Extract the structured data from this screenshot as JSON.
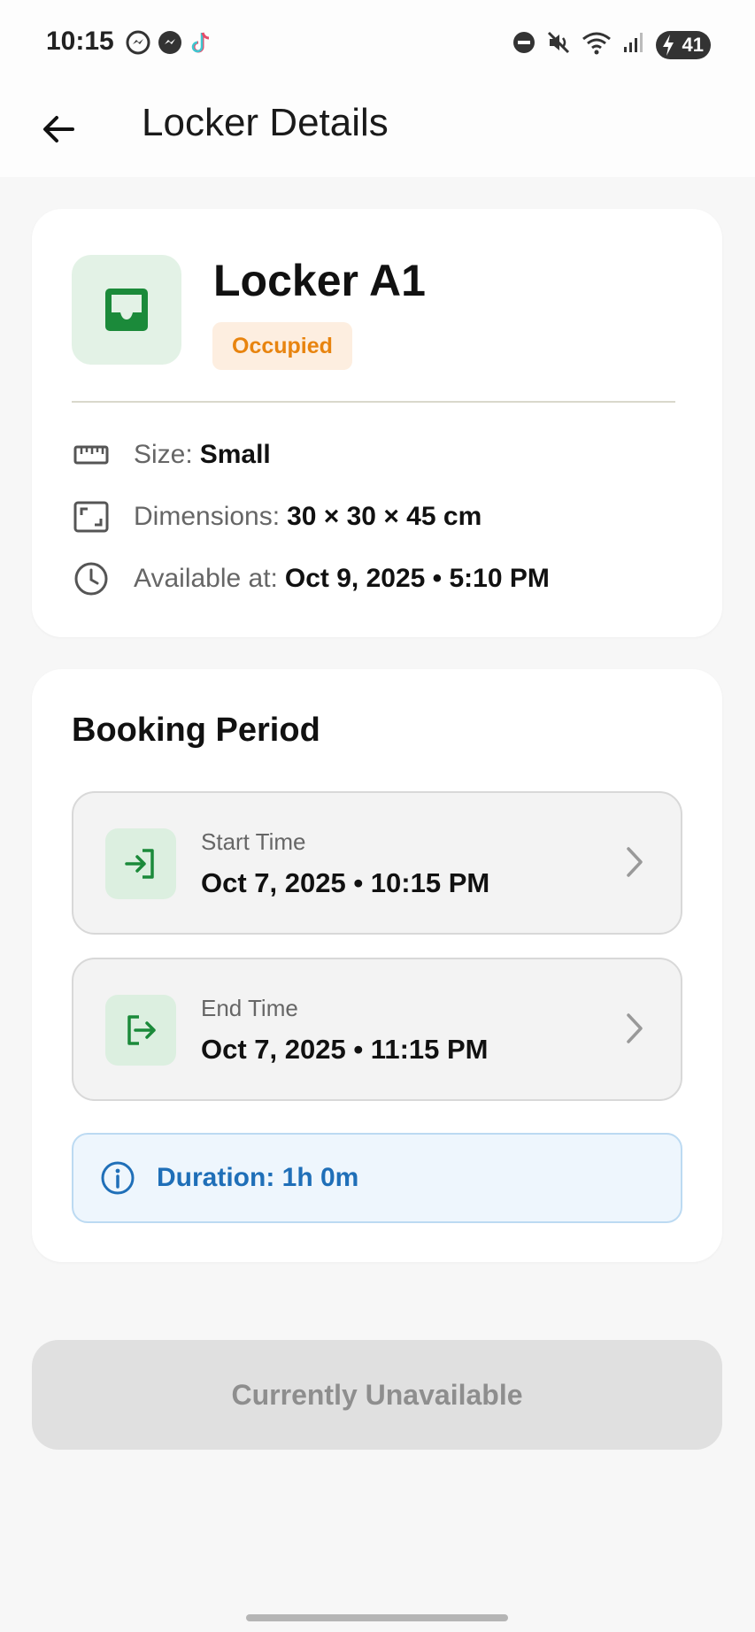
{
  "status_bar": {
    "time": "10:15",
    "battery": "41",
    "left_icons": [
      "messenger-icon",
      "messenger-icon",
      "tiktok-icon"
    ],
    "right_icons": [
      "do-not-disturb-icon",
      "mute-icon",
      "wifi-icon",
      "signal-icon",
      "battery-icon"
    ]
  },
  "app_bar": {
    "title": "Locker Details"
  },
  "locker": {
    "name": "Locker A1",
    "status": "Occupied",
    "status_color": "#e8840f",
    "accent_color": "#1b8a3a",
    "details": {
      "size_label": "Size:",
      "size_value": "Small",
      "dimensions_label": "Dimensions:",
      "dimensions_value": "30 × 30 × 45 cm",
      "available_label": "Available at:",
      "available_value": "Oct 9, 2025 • 5:10 PM"
    }
  },
  "booking": {
    "title": "Booking Period",
    "start": {
      "label": "Start Time",
      "value": "Oct 7, 2025 • 10:15 PM"
    },
    "end": {
      "label": "End Time",
      "value": "Oct 7, 2025 • 11:15 PM"
    },
    "duration": "Duration: 1h 0m"
  },
  "action": {
    "label": "Currently Unavailable"
  }
}
